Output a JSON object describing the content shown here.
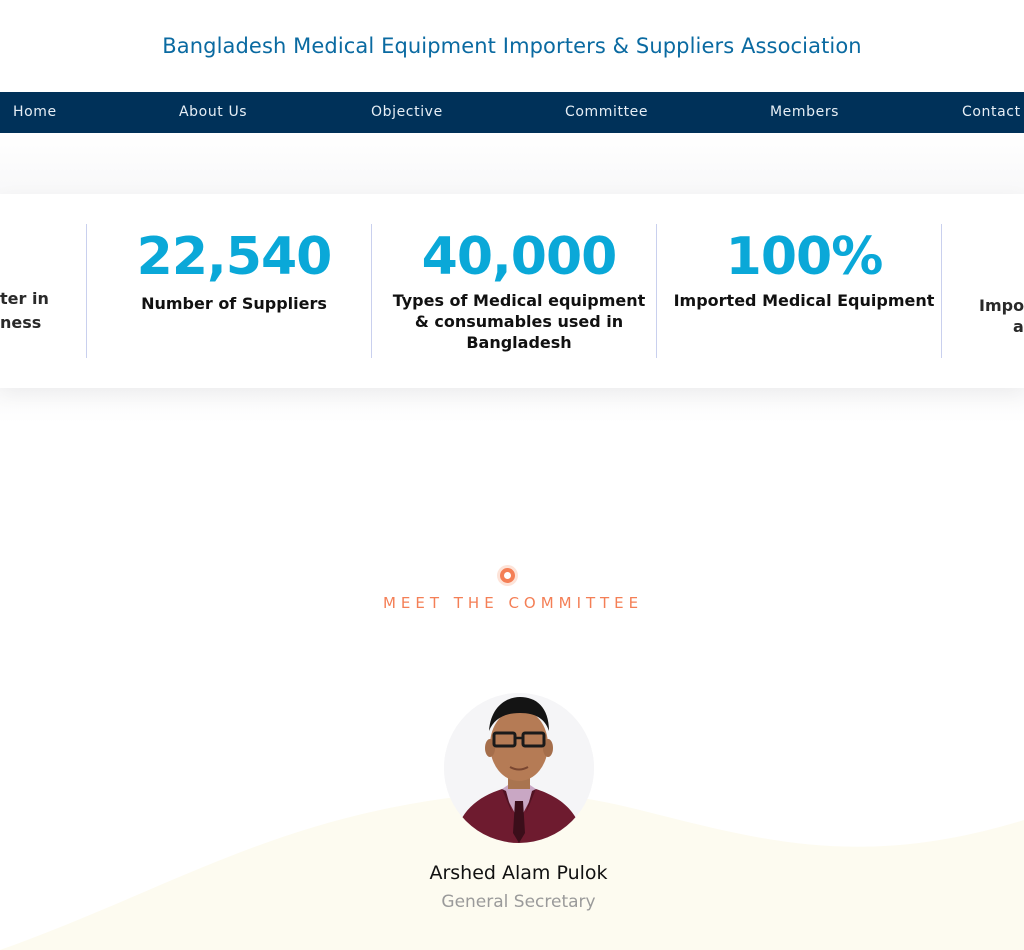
{
  "header": {
    "title": "Bangladesh Medical Equipment Importers & Suppliers Association"
  },
  "nav": {
    "items": [
      "Home",
      "About Us",
      "Objective",
      "Committee",
      "Members",
      "Contact"
    ]
  },
  "stats": {
    "left_partial": [
      "ter in",
      "ness"
    ],
    "items": [
      {
        "number": "22,540",
        "label": "Number of Suppliers"
      },
      {
        "number": "40,000",
        "label": "Types of Medical equipment & consumables used in Bangladesh"
      },
      {
        "number": "100%",
        "label": "Imported Medical Equipment"
      }
    ],
    "right_partial": [
      "Impo",
      "a"
    ]
  },
  "committee": {
    "heading": "MEET THE COMMITTEE",
    "member": {
      "name": "Arshed Alam Pulok",
      "role": "General Secretary"
    }
  },
  "colors": {
    "nav_bg": "#003159",
    "title": "#0a6aa1",
    "stat_number": "#0aa8d8",
    "accent": "#f47f56"
  }
}
